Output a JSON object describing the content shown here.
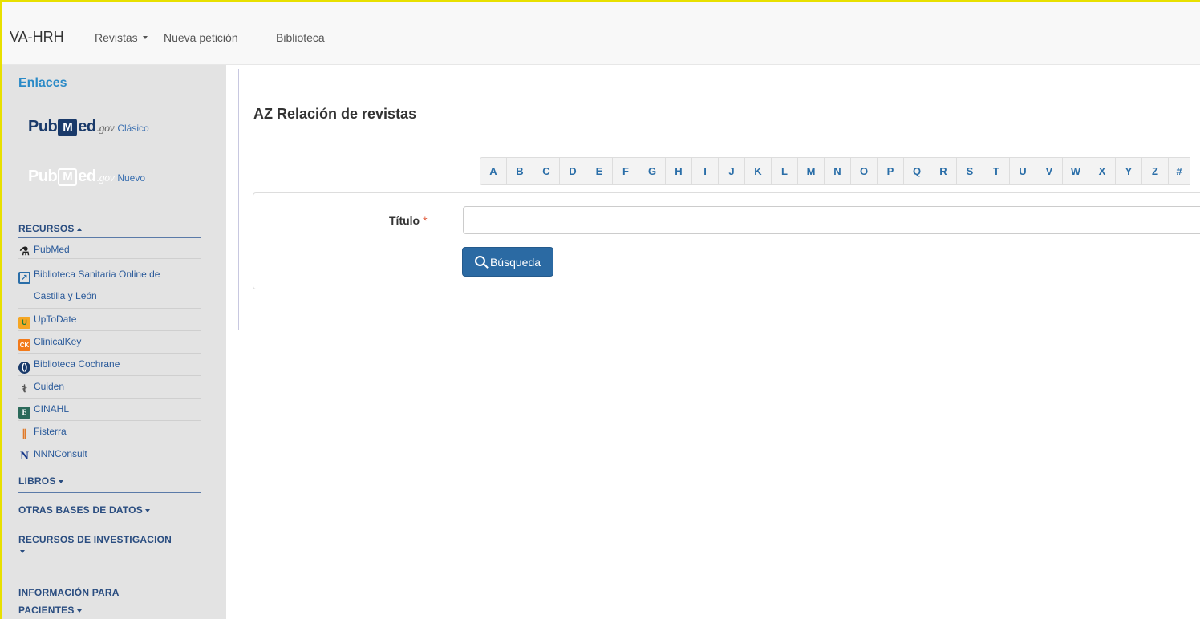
{
  "navbar": {
    "brand": "VA-HRH",
    "items": [
      {
        "label": "Revistas",
        "dropdown": true
      },
      {
        "label": "Nueva petición",
        "dropdown": false
      },
      {
        "label": "Biblioteca",
        "dropdown": false
      }
    ]
  },
  "sidebar": {
    "header": "Enlaces",
    "pubmed_classic": {
      "pub": "Pub",
      "m": "M",
      "ed": "ed",
      "gov": ".gov",
      "label": "Clásico"
    },
    "pubmed_new": {
      "pub": "Pub",
      "m": "M",
      "ed": "ed",
      "gov": ".gov",
      "label": "Nuevo"
    },
    "sections": {
      "recursos": "RECURSOS",
      "libros": "LIBROS",
      "otras": "OTRAS BASES DE DATOS",
      "investigacion": "RECURSOS DE INVESTIGACION",
      "pacientes_1": "INFORMACIÓN PARA",
      "pacientes_2": "PACIENTES"
    },
    "resources": [
      {
        "label": "PubMed",
        "icon": "dna-icon"
      },
      {
        "label": "Biblioteca Sanitaria Online de",
        "label2": "Castilla y León",
        "icon": "external-link-icon"
      },
      {
        "label": "UpToDate",
        "icon": "uptodate-icon"
      },
      {
        "label": "ClinicalKey",
        "icon": "clinicalkey-icon"
      },
      {
        "label": "Biblioteca Cochrane",
        "icon": "cochrane-icon"
      },
      {
        "label": "Cuiden",
        "icon": "cuiden-icon"
      },
      {
        "label": "CINAHL",
        "icon": "cinahl-icon"
      },
      {
        "label": "Fisterra",
        "icon": "fisterra-icon"
      },
      {
        "label": "NNNConsult",
        "icon": "nnn-icon"
      }
    ]
  },
  "main": {
    "title": "AZ Relación de revistas",
    "alphabet": [
      "A",
      "B",
      "C",
      "D",
      "E",
      "F",
      "G",
      "H",
      "I",
      "J",
      "K",
      "L",
      "M",
      "N",
      "O",
      "P",
      "Q",
      "R",
      "S",
      "T",
      "U",
      "V",
      "W",
      "X",
      "Y",
      "Z",
      "#"
    ],
    "form": {
      "title_label": "Título",
      "required_mark": "*",
      "title_value": "",
      "search_button": "Búsqueda"
    }
  },
  "colors": {
    "brand_blue": "#2b6aa3",
    "link_blue": "#2a6ea8",
    "sidebar_bg": "#e3e3e3",
    "frame_yellow": "#e8e000"
  }
}
